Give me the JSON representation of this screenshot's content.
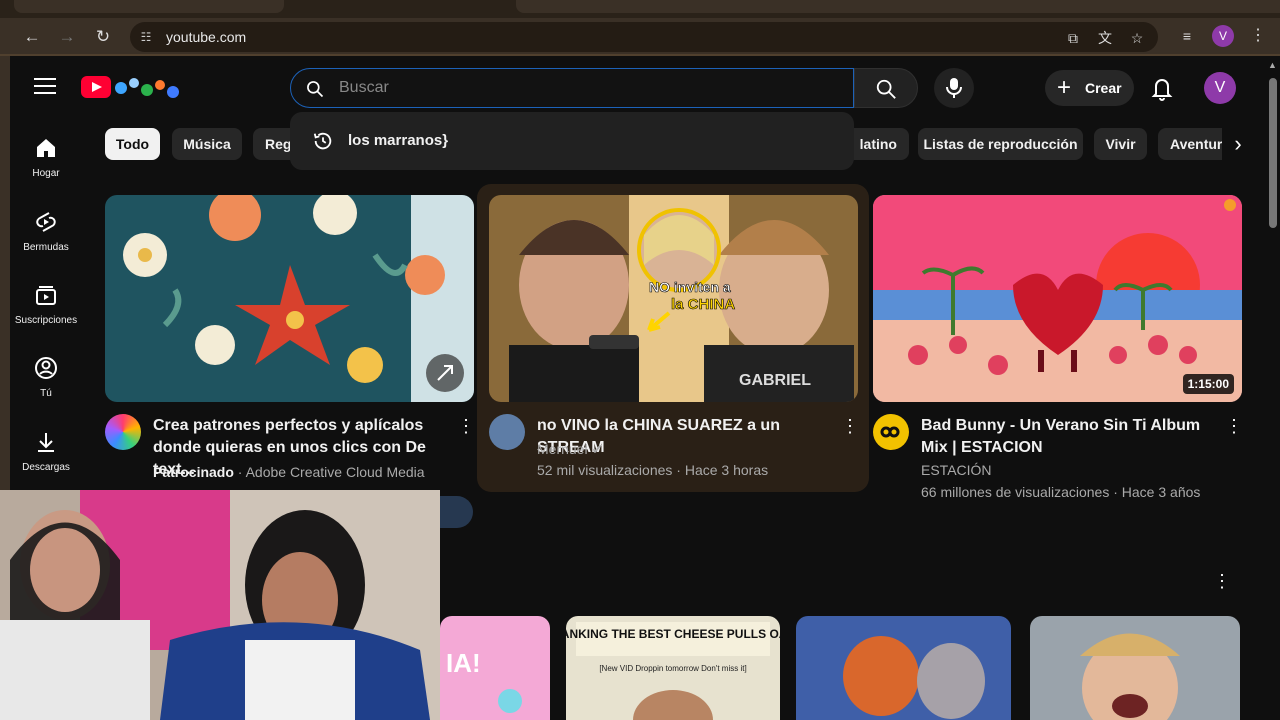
{
  "browser": {
    "url": "youtube.com",
    "profile_initial": "V"
  },
  "header": {
    "search_placeholder": "Buscar",
    "create_label": "Crear",
    "avatar_initial": "V"
  },
  "suggestion": {
    "text": "los marranos}"
  },
  "sidebar": {
    "items": [
      {
        "label": "Hogar",
        "icon": "home-icon"
      },
      {
        "label": "Bermudas",
        "icon": "shorts-icon"
      },
      {
        "label": "Suscripciones",
        "icon": "subscriptions-icon"
      },
      {
        "label": "Tú",
        "icon": "you-icon"
      },
      {
        "label": "Descargas",
        "icon": "download-icon"
      }
    ]
  },
  "chips": [
    {
      "label": "Todo",
      "active": true
    },
    {
      "label": "Música",
      "active": false
    },
    {
      "label": "Reg",
      "active": false
    },
    {
      "label": "latino",
      "active": false
    },
    {
      "label": "Listas de reproducción",
      "active": false
    },
    {
      "label": "Vivir",
      "active": false
    },
    {
      "label": "Aventura",
      "active": false
    }
  ],
  "videos": [
    {
      "title": "Crea patrones perfectos y aplícalos donde quieras en unos clics con De text...",
      "channel_prefix": "Patrocinado",
      "channel": "Adobe Creative Cloud Media",
      "views": "",
      "age": ""
    },
    {
      "title": "no VINO la CHINA SUAREZ a un STREAM",
      "channel": "Mernuel",
      "views": "52 mil visualizaciones",
      "age": "Hace 3 horas",
      "thumb_text_1": "NO inviten a",
      "thumb_text_2": "la CHINA"
    },
    {
      "title": "Bad Bunny - Un Verano Sin Ti Album Mix | ESTACION",
      "channel": "ESTACIÓN",
      "views": "66 millones de visualizaciones",
      "age": "Hace 3 años",
      "duration": "1:15:00"
    }
  ],
  "shorts": [
    {
      "thumb_text": "IA!"
    },
    {
      "thumb_text": "RANKING THE BEST CHEESE PULLS OAT",
      "sub_text": "[New VID Droppin tomorrow Don't miss it]"
    },
    {
      "thumb_text": ""
    },
    {
      "thumb_text": ""
    }
  ],
  "colors": {
    "bg": "#0f0f0f",
    "accent": "#ff0033",
    "chip_bg": "#272727",
    "search_focus": "#1c62b9"
  }
}
